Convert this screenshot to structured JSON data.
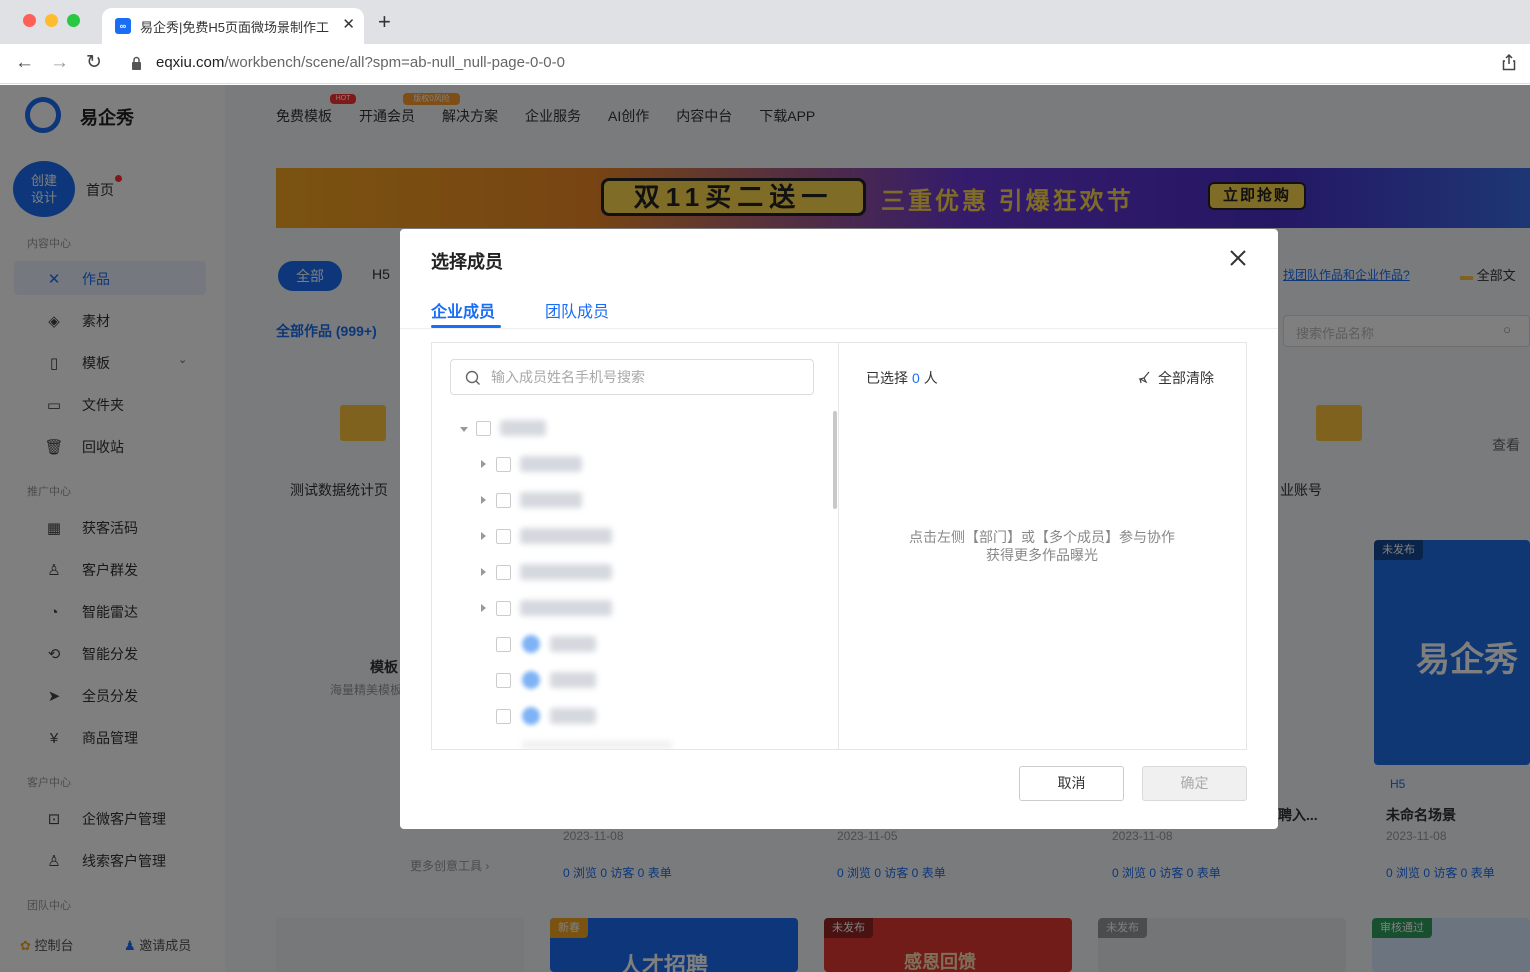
{
  "browser": {
    "tab_title": "易企秀|免费H5页面微场景制作工",
    "tab_favicon": "∞",
    "url_host": "eqxiu.com",
    "url_path": "/workbench/scene/all?spm=ab-null_null-page-0-0-0"
  },
  "app": {
    "brand": "易企秀",
    "create_button": [
      "创建",
      "设计"
    ],
    "home": "首页",
    "sections": {
      "content": "内容中心",
      "promo": "推广中心",
      "customer": "客户中心",
      "team": "团队中心"
    },
    "content_items": [
      {
        "label": "作品",
        "icon": "works-icon"
      },
      {
        "label": "素材",
        "icon": "layers-icon"
      },
      {
        "label": "模板",
        "icon": "template-icon"
      },
      {
        "label": "文件夹",
        "icon": "folder-icon"
      },
      {
        "label": "回收站",
        "icon": "trash-icon"
      }
    ],
    "promo_items": [
      {
        "label": "获客活码",
        "icon": "qrcode-icon"
      },
      {
        "label": "客户群发",
        "icon": "user-send-icon"
      },
      {
        "label": "智能雷达",
        "icon": "radar-icon"
      },
      {
        "label": "智能分发",
        "icon": "distribute-icon"
      },
      {
        "label": "全员分发",
        "icon": "send-icon"
      },
      {
        "label": "商品管理",
        "icon": "goods-icon"
      }
    ],
    "customer_items": [
      {
        "label": "企微客户管理",
        "icon": "wecom-icon"
      },
      {
        "label": "线索客户管理",
        "icon": "leads-icon"
      }
    ],
    "bottom_links": [
      "控制台",
      "邀请成员"
    ],
    "top_nav": [
      "免费模板",
      "开通会员",
      "解决方案",
      "企业服务",
      "AI创作",
      "内容中台",
      "下载APP"
    ],
    "top_nav_badges": {
      "hot": "HOT",
      "vip": "版权0风险"
    },
    "banner": {
      "main": "双11买二送一",
      "sub": "三重优惠 引爆狂欢节",
      "cta": "立即抢购"
    },
    "filters": {
      "all": "全部",
      "h5": "H5"
    },
    "works_count": "全部作品 (999+)",
    "top_right_link": "找团队作品和企业作品?",
    "top_right_folder": "全部文",
    "search_placeholder": "搜索作品名称",
    "bg_cards": {
      "stat_page": "测试数据统计页",
      "enterprise_account": "业账号",
      "template_label": "模板",
      "template_sub": "海量精美模板",
      "view_more": "查看",
      "more_tools": "更多创意工具 ›",
      "unnamed_scene": "未命名场景",
      "hiring": "聘入...",
      "h5_tag": "H5",
      "unpublished": "未发布",
      "approved": "审核通过",
      "new_year": "新春",
      "date": "2023-11-08",
      "date2": "2023-11-05",
      "stats": "0 浏览  0 访客  0 表单",
      "card_titles": [
        "人才招聘",
        "感恩回馈"
      ]
    }
  },
  "modal": {
    "title": "选择成员",
    "tabs": [
      "企业成员",
      "团队成员"
    ],
    "search_placeholder": "输入成员姓名手机号搜索",
    "selected_prefix": "已选择",
    "selected_count": "0",
    "selected_suffix": "人",
    "clear_all": "全部清除",
    "empty_tip_line1": "点击左侧【部门】或【多个成员】参与协作",
    "empty_tip_line2": "获得更多作品曝光",
    "cancel": "取消",
    "confirm": "确定"
  }
}
